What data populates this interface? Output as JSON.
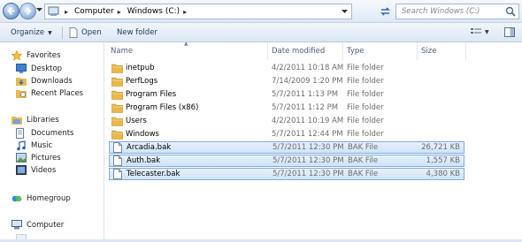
{
  "address_bar": {
    "crumbs": [
      "Computer",
      "Windows (C:)"
    ]
  },
  "search": {
    "placeholder": "Search Windows (C:)"
  },
  "toolbar": {
    "organize_label": "Organize",
    "open_label": "Open",
    "new_folder_label": "New folder"
  },
  "nav_pane": {
    "favorites_label": "Favorites",
    "favorites": [
      "Desktop",
      "Downloads",
      "Recent Places"
    ],
    "libraries_label": "Libraries",
    "libraries": [
      "Documents",
      "Music",
      "Pictures",
      "Videos"
    ],
    "homegroup_label": "Homegroup",
    "computer_label": "Computer"
  },
  "columns": {
    "name": "Name",
    "date": "Date modified",
    "type": "Type",
    "size": "Size"
  },
  "files": [
    {
      "name": "inetpub",
      "date": "4/2/2011 10:18 AM",
      "type": "File folder",
      "size": "",
      "kind": "folder",
      "selected": false
    },
    {
      "name": "PerfLogs",
      "date": "7/14/2009 1:20 PM",
      "type": "File folder",
      "size": "",
      "kind": "folder",
      "selected": false
    },
    {
      "name": "Program Files",
      "date": "5/7/2011 1:13 PM",
      "type": "File folder",
      "size": "",
      "kind": "folder",
      "selected": false
    },
    {
      "name": "Program Files (x86)",
      "date": "5/7/2011 1:12 PM",
      "type": "File folder",
      "size": "",
      "kind": "folder",
      "selected": false
    },
    {
      "name": "Users",
      "date": "4/2/2011 10:19 AM",
      "type": "File folder",
      "size": "",
      "kind": "folder",
      "selected": false
    },
    {
      "name": "Windows",
      "date": "5/7/2011 12:44 PM",
      "type": "File folder",
      "size": "",
      "kind": "folder",
      "selected": false
    },
    {
      "name": "Arcadia.bak",
      "date": "5/7/2011 12:30 PM",
      "type": "BAK File",
      "size": "26,721 KB",
      "kind": "file",
      "selected": true
    },
    {
      "name": "Auth.bak",
      "date": "5/7/2011 12:30 PM",
      "type": "BAK File",
      "size": "1,557 KB",
      "kind": "file",
      "selected": true
    },
    {
      "name": "Telecaster.bak",
      "date": "5/7/2011 12:30 PM",
      "type": "BAK File",
      "size": "4,380 KB",
      "kind": "file",
      "selected": true
    }
  ],
  "colors": {
    "selection_fill": "#cfe3f9",
    "selection_border": "#84acdd",
    "folder": "#e8b84a",
    "toolbar_text": "#1e395b"
  }
}
